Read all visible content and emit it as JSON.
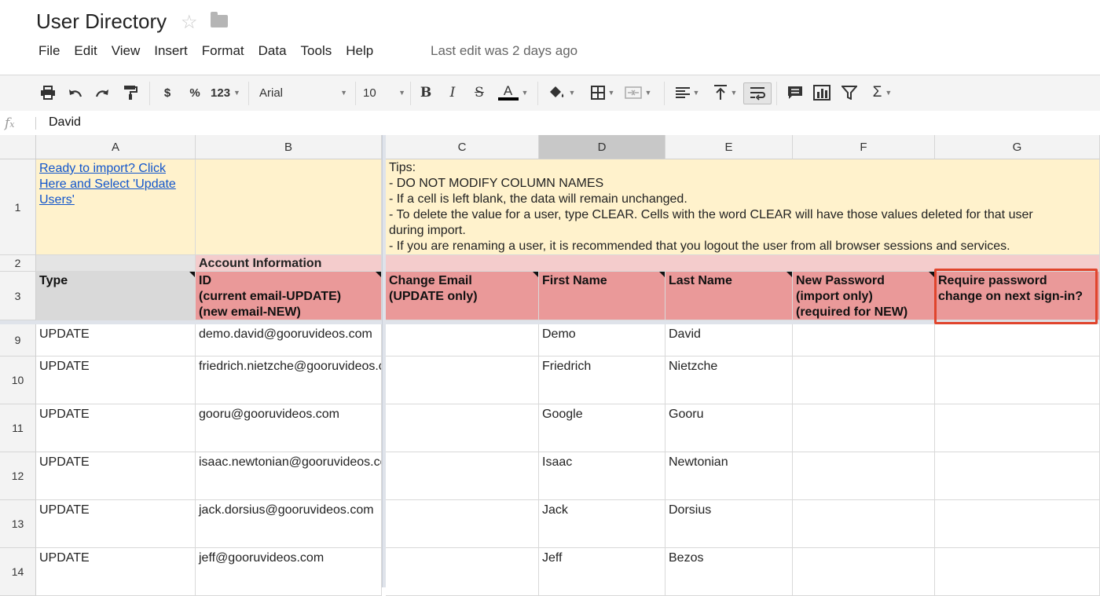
{
  "doc": {
    "title": "User Directory",
    "last_edit": "Last edit was 2 days ago"
  },
  "menu": [
    "File",
    "Edit",
    "View",
    "Insert",
    "Format",
    "Data",
    "Tools",
    "Help"
  ],
  "toolbar": {
    "currency": "$",
    "percent": "%",
    "number_format": "123",
    "font_family": "Arial",
    "font_size": "10",
    "bold": "B",
    "italic": "I",
    "strike": "S",
    "text_color": "A",
    "sum": "Σ",
    "icons": [
      "print-icon",
      "undo-icon",
      "redo-icon",
      "paint-format-icon",
      "fill-color-icon",
      "borders-icon",
      "merge-cells-icon",
      "horizontal-align-icon",
      "vertical-align-icon",
      "wrap-text-icon",
      "comment-icon",
      "chart-icon",
      "filter-icon",
      "functions-icon"
    ]
  },
  "formula_bar": {
    "fx": "fx",
    "value": "David"
  },
  "columns": [
    "A",
    "B",
    "C",
    "D",
    "E",
    "F",
    "G"
  ],
  "row1": {
    "link": "Ready to import? Click Here and Select 'Update Users'",
    "tips": [
      "Tips:",
      "- DO NOT MODIFY COLUMN NAMES",
      "- If a cell is left blank, the data will remain unchanged.",
      "- To delete the value for a user, type CLEAR. Cells with the word CLEAR will have those values deleted for that user",
      "during import.",
      "- If you are renaming a user, it is recommended that you logout the user from all browser sessions and services."
    ]
  },
  "row2": {
    "section": "Account Information"
  },
  "headers": {
    "A": "Type",
    "B": "ID\n(current email-UPDATE)\n(new email-NEW)",
    "C": "Change Email\n(UPDATE only)",
    "D": "First Name",
    "E": "Last Name",
    "F": "New Password\n(import only)\n(required for NEW)",
    "G": "Require password\nchange on next sign-in?"
  },
  "rows": [
    {
      "num": "9",
      "type": "UPDATE",
      "id": "demo.david@gooruvideos.com",
      "first": "Demo",
      "last": "David"
    },
    {
      "num": "10",
      "type": "UPDATE",
      "id": "friedrich.nietzche@gooruvideos.com",
      "first": "Friedrich",
      "last": "Nietzche"
    },
    {
      "num": "11",
      "type": "UPDATE",
      "id": "gooru@gooruvideos.com",
      "first": "Google",
      "last": "Gooru"
    },
    {
      "num": "12",
      "type": "UPDATE",
      "id": "isaac.newtonian@gooruvideos.com",
      "first": "Isaac",
      "last": "Newtonian"
    },
    {
      "num": "13",
      "type": "UPDATE",
      "id": "jack.dorsius@gooruvideos.com",
      "first": "Jack",
      "last": "Dorsius"
    },
    {
      "num": "14",
      "type": "UPDATE",
      "id": "jeff@gooruvideos.com",
      "first": "Jeff",
      "last": "Bezos"
    }
  ],
  "row_labels": [
    "1",
    "2",
    "3"
  ],
  "colors": {
    "yellow": "#fff2cc",
    "pink": "#ea9999",
    "pink_light": "#f4cccc",
    "highlight_box": "#e0452d",
    "link": "#1155cc"
  }
}
